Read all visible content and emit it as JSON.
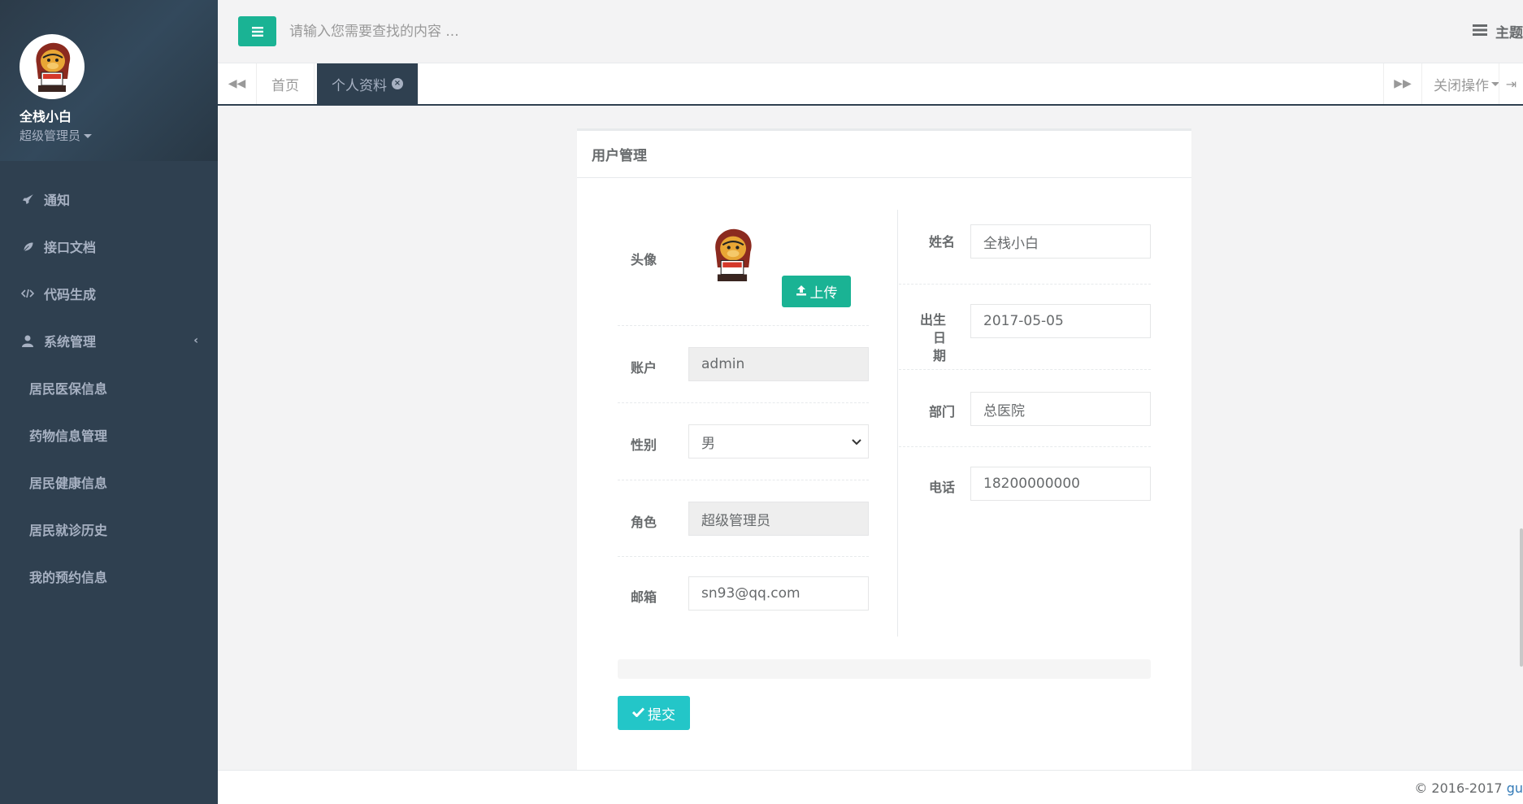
{
  "sidebar": {
    "user_name": "全栈小白",
    "user_role": "超级管理员",
    "nav": [
      {
        "label": "通知",
        "icon": "rocket-icon"
      },
      {
        "label": "接口文档",
        "icon": "leaf-icon"
      },
      {
        "label": "代码生成",
        "icon": "code-icon"
      },
      {
        "label": "系统管理",
        "icon": "user-icon"
      }
    ],
    "sub_items": [
      "居民医保信息",
      "药物信息管理",
      "居民健康信息",
      "居民就诊历史",
      "我的预约信息"
    ]
  },
  "topbar": {
    "search_placeholder": "请输入您需要查找的内容 ...",
    "theme_label": "主题"
  },
  "tabs": {
    "home": "首页",
    "active": "个人资料",
    "close_ops": "关闭操作"
  },
  "panel": {
    "title": "用户管理",
    "fields": {
      "avatar_label": "头像",
      "upload_label": "上传",
      "account_label": "账户",
      "account_value": "admin",
      "gender_label": "性别",
      "gender_value": "男",
      "role_label": "角色",
      "role_value": "超级管理员",
      "email_label": "邮箱",
      "email_value": "sn93@qq.com",
      "name_label": "姓名",
      "name_value": "全栈小白",
      "birth_label_1": "出生日",
      "birth_label_2": "期",
      "birth_value": "2017-05-05",
      "dept_label": "部门",
      "dept_value": "总医院",
      "phone_label": "电话",
      "phone_value": "18200000000"
    },
    "submit_label": "提交"
  },
  "footer": {
    "copyright": "© 2016-2017 ",
    "link": "gu"
  },
  "colors": {
    "sidebar_bg": "#2f4050",
    "primary": "#1ab394",
    "info": "#23c6c8"
  }
}
